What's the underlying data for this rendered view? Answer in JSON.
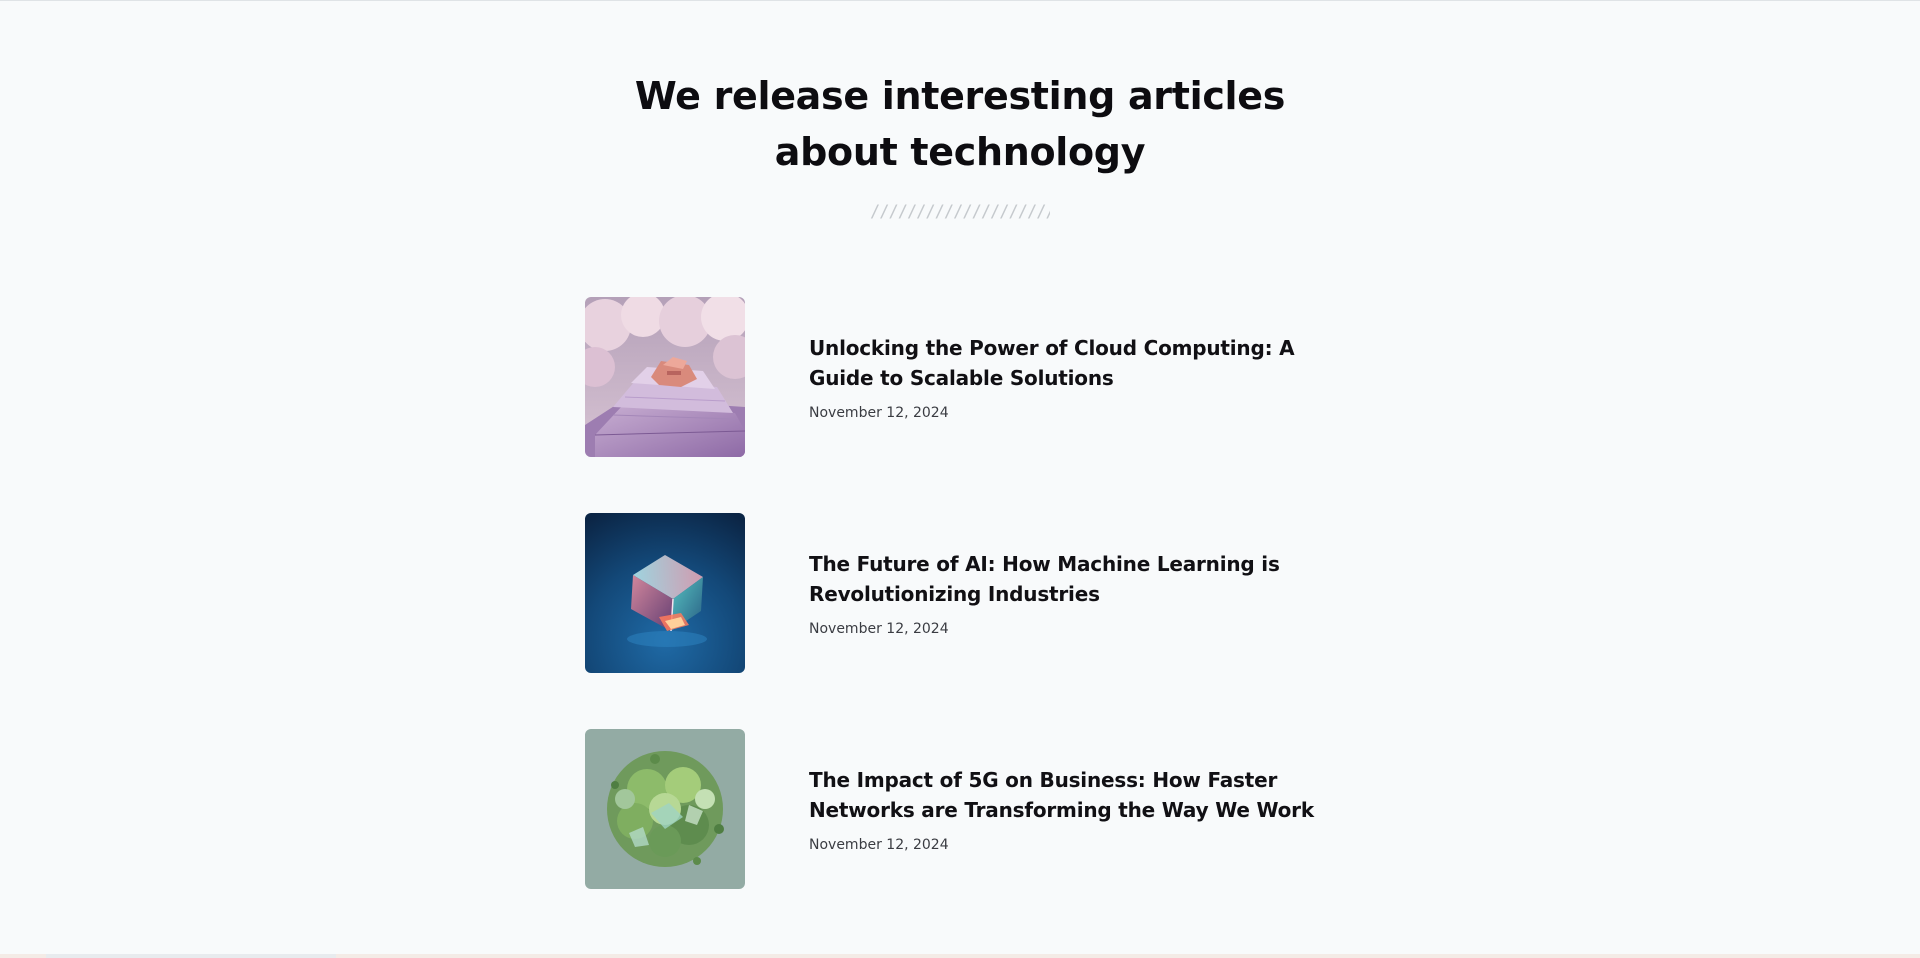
{
  "section": {
    "title": "We release interesting articles about technology",
    "divider": "//////////////////////"
  },
  "articles": [
    {
      "title": "Unlocking the Power of Cloud Computing: A Guide to Scalable Solutions",
      "date": "November 12, 2024",
      "image": "cloud-steps-image"
    },
    {
      "title": "The Future of AI: How Machine Learning is Revolutionizing Industries",
      "date": "November 12, 2024",
      "image": "glass-cube-image"
    },
    {
      "title": "The Impact of 5G on Business: How Faster Networks are Transforming the Way We Work",
      "date": "November 12, 2024",
      "image": "green-sphere-image"
    }
  ],
  "colors": {
    "background": "#f8fafb",
    "text": "#0f0f12",
    "date": "#3a3c42",
    "divider": "#c5c9cd"
  }
}
